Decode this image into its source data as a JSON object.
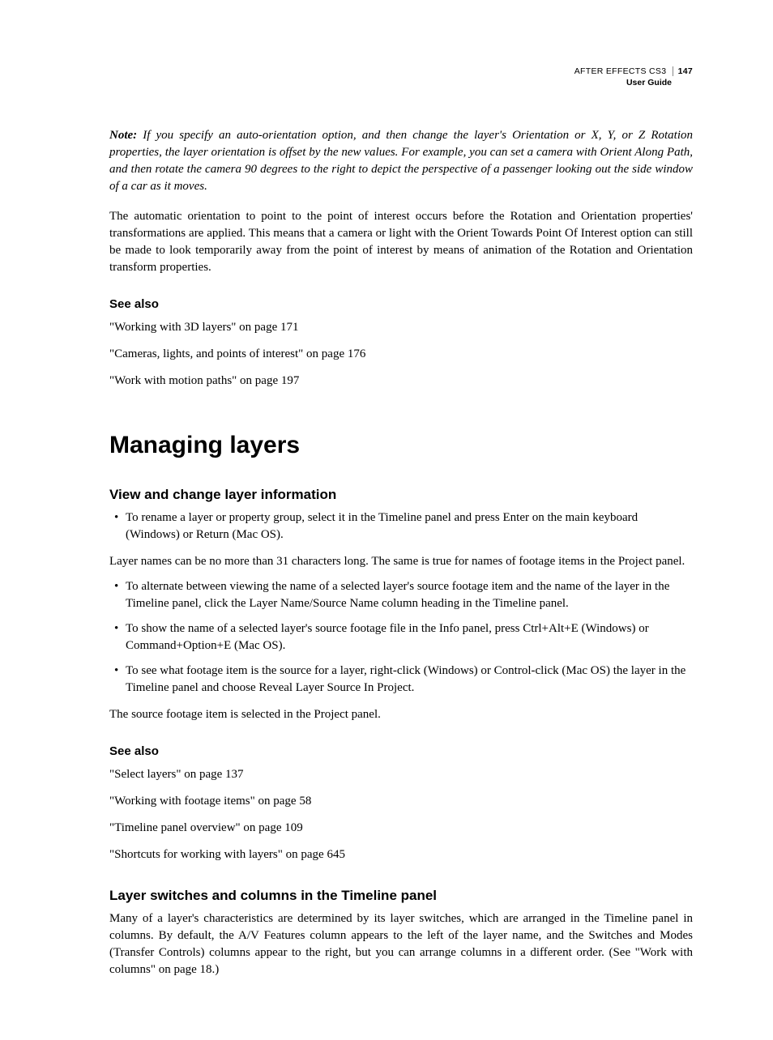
{
  "header": {
    "product": "AFTER EFFECTS CS3",
    "page_number": "147",
    "subtitle": "User Guide"
  },
  "note": {
    "label": "Note:",
    "text": " If you specify an auto-orientation option, and then change the layer's Orientation or X, Y, or Z Rotation properties, the layer orientation is offset by the new values. For example, you can set a camera with Orient Along Path, and then rotate the camera 90 degrees to the right to depict the perspective of a passenger looking out the side window of a car as it moves."
  },
  "para_auto_orient": "The automatic orientation to point to the point of interest occurs before the Rotation and Orientation properties' transformations are applied. This means that a camera or light with the Orient Towards Point Of Interest option can still be made to look temporarily away from the point of interest by means of animation of the Rotation and Orientation transform properties.",
  "see_also_1": {
    "heading": "See also",
    "refs": [
      "\"Working with 3D layers\" on page 171",
      "\"Cameras, lights, and points of interest\" on page 176",
      "\"Work with motion paths\" on page 197"
    ]
  },
  "section_heading": "Managing layers",
  "subsection_1": {
    "heading": "View and change layer information",
    "bullet_1": "To rename a layer or property group, select it in the Timeline panel and press Enter on the main keyboard (Windows) or Return (Mac OS).",
    "para_1": "Layer names can be no more than 31 characters long. The same is true for names of footage items in the Project panel.",
    "bullets_2": [
      "To alternate between viewing the name of a selected layer's source footage item and the name of the layer in the Timeline panel, click the Layer Name/Source Name column heading in the Timeline panel.",
      "To show the name of a selected layer's source footage file in the Info panel, press Ctrl+Alt+E (Windows) or Command+Option+E (Mac OS).",
      "To see what footage item is the source for a layer, right-click (Windows) or Control-click (Mac OS) the layer in the Timeline panel and choose Reveal Layer Source In Project."
    ],
    "para_2": "The source footage item is selected in the Project panel."
  },
  "see_also_2": {
    "heading": "See also",
    "refs": [
      "\"Select layers\" on page 137",
      "\"Working with footage items\" on page 58",
      "\"Timeline panel overview\" on page 109",
      "\"Shortcuts for working with layers\" on page 645"
    ]
  },
  "subsection_2": {
    "heading": "Layer switches and columns in the Timeline panel",
    "para": "Many of a layer's characteristics are determined by its layer switches, which are arranged in the Timeline panel in columns. By default, the A/V Features column appears to the left of the layer name, and the Switches and Modes (Transfer Controls) columns appear to the right, but you can arrange columns in a different order. (See \"Work with columns\" on page 18.)"
  }
}
